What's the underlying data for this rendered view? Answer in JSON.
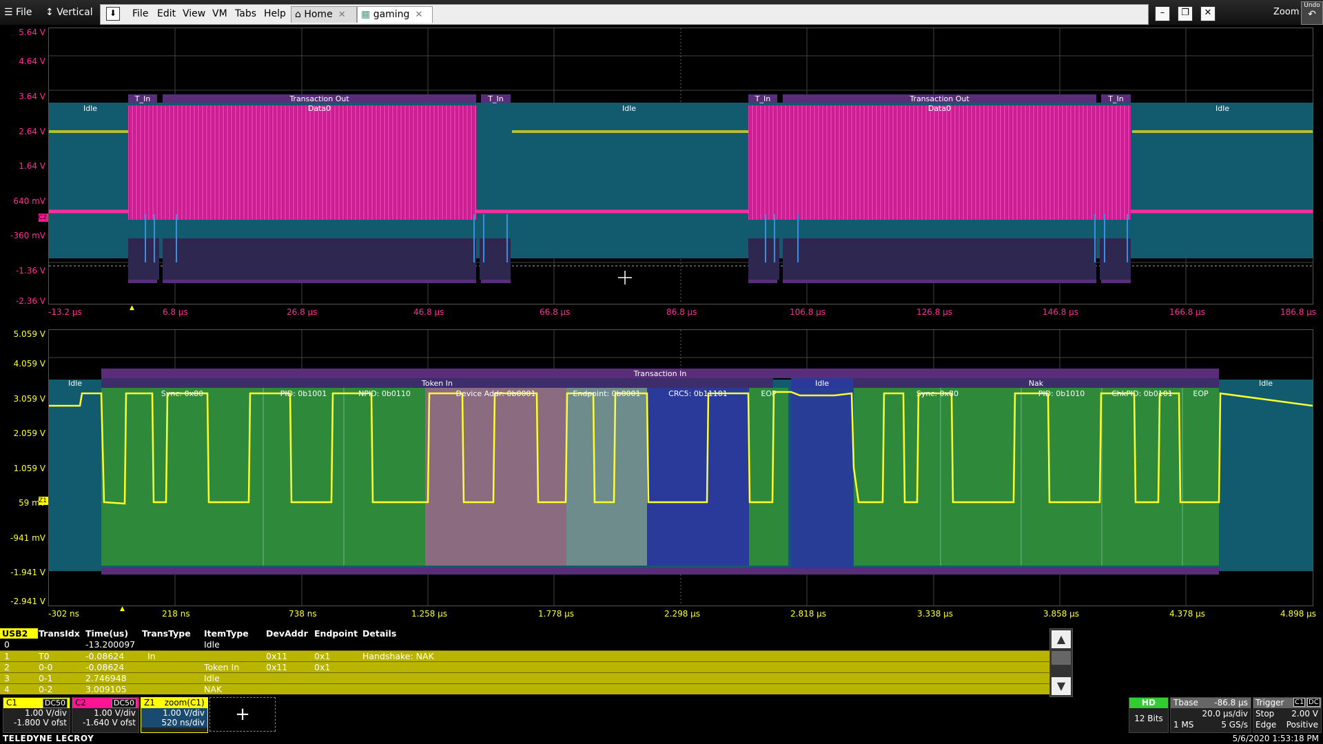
{
  "menubar": {
    "file_label": "File",
    "vertical_label": "Vertical",
    "menu_items": [
      "File",
      "Edit",
      "View",
      "VM",
      "Tabs",
      "Help"
    ],
    "tabs": [
      {
        "label": "Home"
      },
      {
        "label": "gaming"
      }
    ],
    "zoom_label": "Zoom",
    "undo_label": "Undo"
  },
  "top_panel": {
    "y_labels": [
      "5.64 V",
      "4.64 V",
      "3.64 V",
      "2.64 V",
      "1.64 V",
      "640 mV",
      "-360 mV",
      "-1.36 V",
      "-2.36 V"
    ],
    "x_labels": [
      "-13.2 µs",
      "6.8 µs",
      "26.8 µs",
      "46.8 µs",
      "66.8 µs",
      "86.8 µs",
      "106.8 µs",
      "126.8 µs",
      "146.8 µs",
      "166.8 µs",
      "186.8 µs"
    ],
    "decode_labels": {
      "idle": "Idle",
      "t_in": "T_In",
      "transaction_out": "Transaction Out",
      "data0": "Data0"
    },
    "marker_c2": "C2"
  },
  "bottom_panel": {
    "y_labels": [
      "5.059 V",
      "4.059 V",
      "3.059 V",
      "2.059 V",
      "1.059 V",
      "59 mV",
      "-941 mV",
      "-1.941 V",
      "-2.941 V"
    ],
    "x_labels": [
      "-302 ns",
      "218 ns",
      "738 ns",
      "1.258 µs",
      "1.778 µs",
      "2.298 µs",
      "2.818 µs",
      "3.338 µs",
      "3.858 µs",
      "4.378 µs",
      "4.898 µs"
    ],
    "decode_labels": {
      "transaction_in": "Transaction In",
      "idle": "Idle",
      "token_in": "Token In",
      "nak": "Nak",
      "sync": "Sync: 0x80",
      "pid": "PID: 0b1001",
      "pid2": "PID: 0b1010",
      "npid": "NPID: 0b0110",
      "device_addr": "Device Addr: 0b0001",
      "endpoint": "Endpoint: 0b0001",
      "crc5": "CRC5: 0b11101",
      "eop": "EOP",
      "chkpid": "ChkPID: 0b0101"
    },
    "marker_z1": "Z1"
  },
  "table": {
    "tag": "USB2",
    "headers": [
      "TransIdx",
      "Time(us)",
      "TransType",
      "ItemType",
      "DevAddr",
      "Endpoint",
      "Details"
    ],
    "rows": [
      {
        "idx": "0",
        "transidx": "",
        "time": "-13.200097",
        "transtype": "",
        "itemtype": "Idle",
        "devaddr": "",
        "endpoint": "",
        "details": ""
      },
      {
        "idx": "1",
        "transidx": "T0",
        "time": "-0.08624",
        "transtype": "In",
        "itemtype": "",
        "devaddr": "0x11",
        "endpoint": "0x1",
        "details": "Handshake: NAK"
      },
      {
        "idx": "2",
        "transidx": "0-0",
        "time": "-0.08624",
        "transtype": "",
        "itemtype": "Token In",
        "devaddr": "0x11",
        "endpoint": "0x1",
        "details": ""
      },
      {
        "idx": "3",
        "transidx": "0-1",
        "time": "2.746948",
        "transtype": "",
        "itemtype": "Idle",
        "devaddr": "",
        "endpoint": "",
        "details": ""
      },
      {
        "idx": "4",
        "transidx": "0-2",
        "time": "3.009105",
        "transtype": "",
        "itemtype": "NAK",
        "devaddr": "",
        "endpoint": "",
        "details": ""
      }
    ]
  },
  "channels": [
    {
      "name": "C1",
      "badge": "DC50",
      "vdiv": "1.00 V/div",
      "ofst": "-1.800 V ofst",
      "color": "#ffff00"
    },
    {
      "name": "C2",
      "badge": "DC50",
      "vdiv": "1.00 V/div",
      "ofst": "-1.640 V ofst",
      "color": "#ff1493"
    },
    {
      "name": "Z1",
      "title": "zoom(C1)",
      "vdiv": "1.00 V/div",
      "tdiv": "520 ns/div",
      "color": "#ffff00"
    }
  ],
  "add_label": "+",
  "acq": {
    "hd": "HD",
    "bits": "12 Bits",
    "tbase_label": "Tbase",
    "tbase_value": "-86.8 µs",
    "tdiv": "20.0 µs/div",
    "ms": "1 MS",
    "rate": "5 GS/s",
    "trigger_label": "Trigger",
    "trigger_ch": "C1",
    "trigger_coupling": "DC",
    "mode": "Stop",
    "level": "2.00 V",
    "type": "Edge",
    "slope": "Positive"
  },
  "footer": {
    "brand": "TELEDYNE LECROY",
    "datetime": "5/6/2020 1:53:18 PM"
  }
}
